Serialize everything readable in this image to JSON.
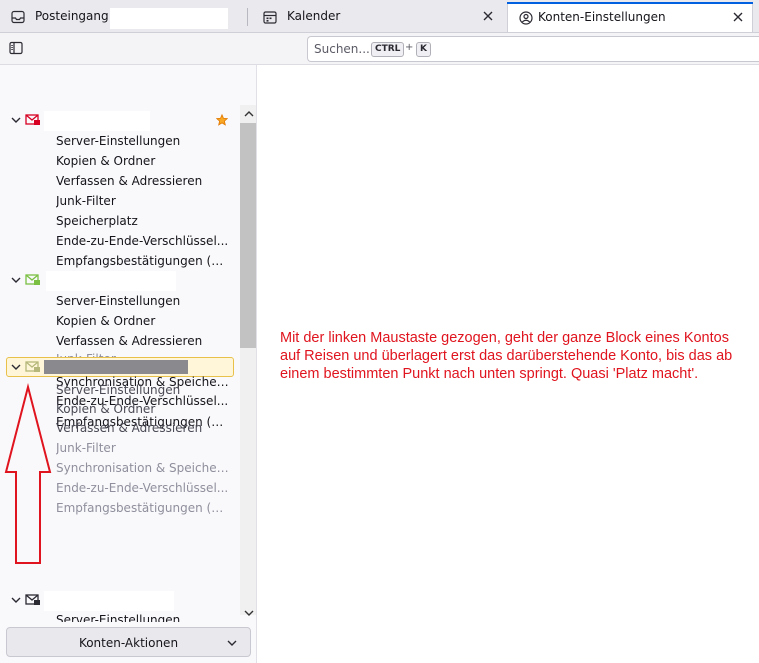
{
  "tabs": [
    {
      "label": "Posteingang -",
      "icon": "inbox-icon"
    },
    {
      "label": "Kalender",
      "icon": "calendar-icon"
    },
    {
      "label": "Konten-Einstellungen",
      "icon": "account-settings-icon"
    }
  ],
  "search": {
    "placeholder": "Suchen...",
    "shortcut_ctrl": "CTRL",
    "shortcut_plus": "+",
    "shortcut_key": "K"
  },
  "accounts": [
    {
      "icon": "mail-account-red-icon",
      "default_star": "star-icon",
      "items": [
        "Server-Einstellungen",
        "Kopien & Ordner",
        "Verfassen & Adressieren",
        "Junk-Filter",
        "Speicherplatz",
        "Ende-zu-Ende-Verschlüssel...",
        "Empfangsbestätigungen (M..."
      ]
    },
    {
      "icon": "mail-account-green-icon",
      "items": [
        "Server-Einstellungen",
        "Kopien & Ordner",
        "Verfassen & Adressieren",
        "Junk-Filter"
      ]
    },
    {
      "icon": "mail-account-green-icon",
      "dragging": true,
      "items": [
        "Synchronisation & Speicher...",
        "Server-Einstellungen",
        "Ende-zu-Ende-Verschlüssel...",
        "Kopien & Ordner",
        "Empfangsbestätigungen (M...",
        "Verfassen & Adressieren"
      ],
      "ghost_items": [
        "Junk-Filter",
        "Synchronisation & Speicher...",
        "Ende-zu-Ende-Verschlüssel...",
        "Empfangsbestätigungen (M..."
      ]
    },
    {
      "icon": "mail-account-dark-icon",
      "items": [
        "Server-Einstellungen"
      ]
    }
  ],
  "actions_button": "Konten-Aktionen",
  "annotation": "Mit der linken Maustaste gezogen, geht der ganze Block eines Kontos auf Reisen und überlagert erst das darüberstehende Konto, bis das ab einem bestimmten Punkt nach unten springt. Quasi 'Platz macht'.",
  "colors": {
    "annotation": "#e0141e",
    "arrow": "#e0141e",
    "drag_highlight": "#fff6d9",
    "accent": "#0060df"
  }
}
